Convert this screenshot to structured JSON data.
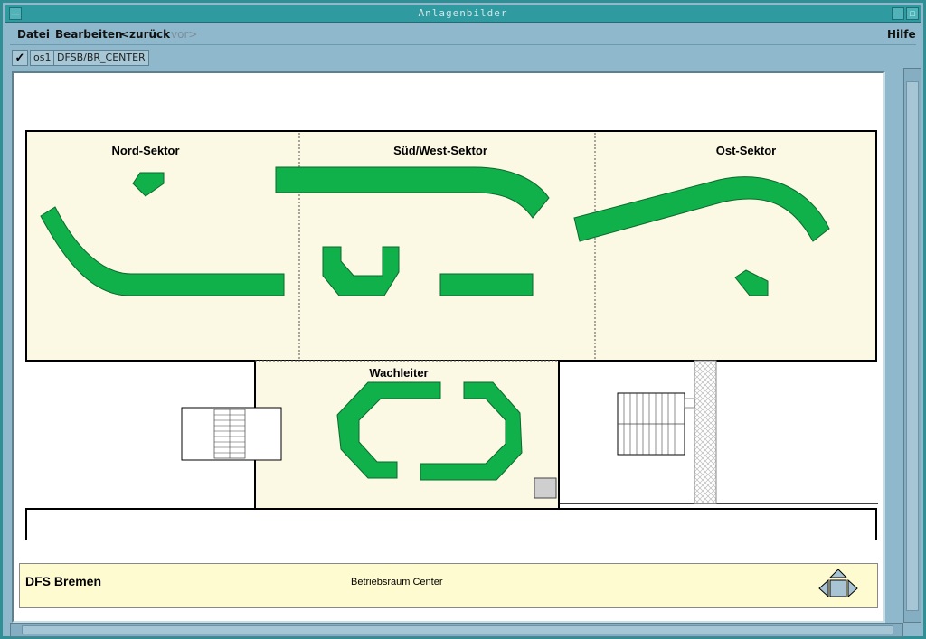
{
  "window": {
    "title": "Anlagenbilder"
  },
  "menu": {
    "datei": "Datei",
    "bearbeiten": "Bearbeiten",
    "zurueck": "<zurück",
    "vor": "vor>",
    "hilfe": "Hilfe"
  },
  "toolbar": {
    "check": "✓",
    "workstation": "os1",
    "path": "DFSB/BR_CENTER"
  },
  "floorplan": {
    "sectors": {
      "nord": "Nord-Sektor",
      "suedwest": "Süd/West-Sektor",
      "ost": "Ost-Sektor",
      "wachleiter": "Wachleiter"
    },
    "colors": {
      "console": "#10b04a",
      "floor": "#fbf8e3"
    }
  },
  "footer": {
    "brand": "DFS Bremen",
    "room": "Betriebsraum Center"
  }
}
